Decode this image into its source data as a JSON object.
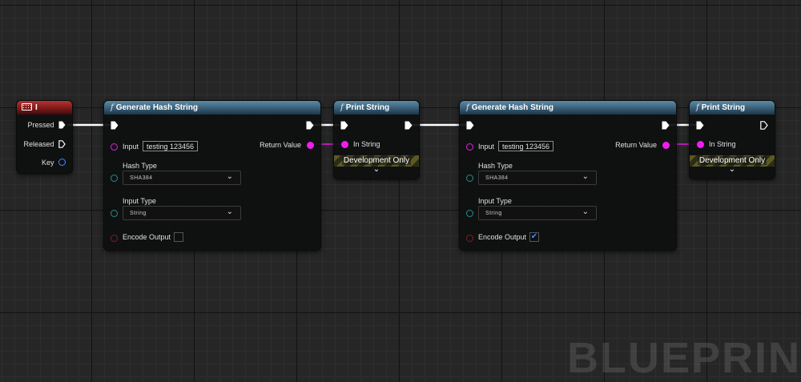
{
  "event_node": {
    "title": "I",
    "pins": {
      "pressed": "Pressed",
      "released": "Released",
      "key": "Key"
    }
  },
  "hash_node_1": {
    "title": "Generate Hash String",
    "input_label": "Input",
    "input_value": "testing 123456",
    "hash_type_label": "Hash Type",
    "hash_type_value": "SHA384",
    "input_type_label": "Input Type",
    "input_type_value": "String",
    "encode_output_label": "Encode Output",
    "encode_output_checked": false,
    "return_value_label": "Return Value"
  },
  "print_node_1": {
    "title": "Print String",
    "in_string_label": "In String",
    "dev_only_label": "Development Only"
  },
  "hash_node_2": {
    "title": "Generate Hash String",
    "input_label": "Input",
    "input_value": "testing 123456",
    "hash_type_label": "Hash Type",
    "hash_type_value": "SHA384",
    "input_type_label": "Input Type",
    "input_type_value": "String",
    "encode_output_label": "Encode Output",
    "encode_output_checked": true,
    "check_glyph": "✔",
    "return_value_label": "Return Value"
  },
  "print_node_2": {
    "title": "Print String",
    "in_string_label": "In String",
    "dev_only_label": "Development Only"
  },
  "watermark": "BLUEPRINT",
  "colors": {
    "exec_wire": "#ffffff",
    "string_pin": "#f01ef0",
    "name_pin": "#2b8a8a",
    "bool_pin": "#8b1a1a",
    "key_pin": "#3f8cff",
    "function_header": "#3e6680",
    "event_header": "#8a1c1c",
    "graph_background": "#262626"
  },
  "icons": [
    "function-icon",
    "keyboard-icon",
    "exec-pin-icon",
    "chevron-down-icon",
    "checkmark-icon"
  ]
}
